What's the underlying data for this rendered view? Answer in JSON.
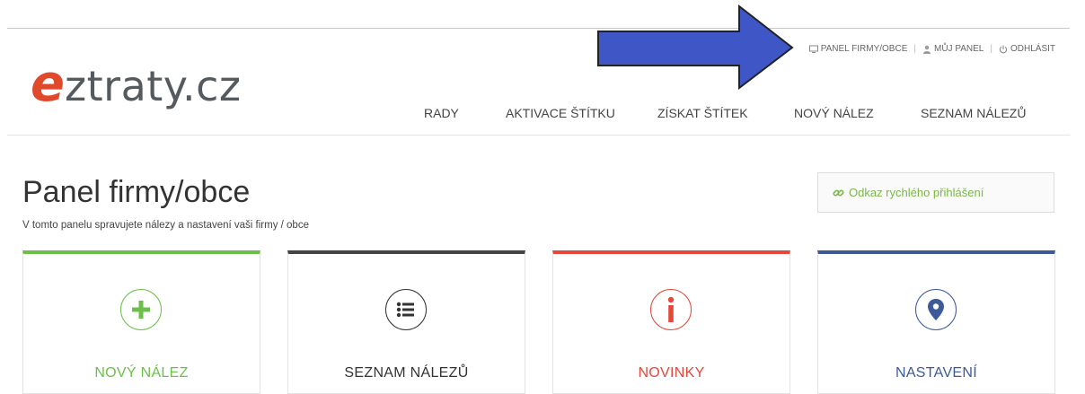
{
  "logo": {
    "e": "e",
    "rest": "ztraty.cz"
  },
  "top_nav": {
    "panel": "PANEL FIRMY/OBCE",
    "my_panel": "MŮJ PANEL",
    "logout": "ODHLÁSIT",
    "separator": "|"
  },
  "main_nav": [
    "RADY",
    "AKTIVACE ŠTÍTKU",
    "ZÍSKAT ŠTÍTEK",
    "NOVÝ NÁLEZ",
    "SEZNAM NÁLEZŮ"
  ],
  "page": {
    "title": "Panel firmy/obce",
    "subtitle": "V tomto panelu spravujete nálezy a nastavení vaši firmy / obce",
    "quick_login": "Odkaz rychlého přihlášení"
  },
  "cards": [
    {
      "label": "NOVÝ NÁLEZ",
      "color": "#6cc04a",
      "icon": "plus-icon"
    },
    {
      "label": "SEZNAM NÁLEZŮ",
      "color": "#444444",
      "icon": "list-icon"
    },
    {
      "label": "NOVINKY",
      "color": "#e5473a",
      "icon": "info-icon"
    },
    {
      "label": "NASTAVENÍ",
      "color": "#3c5a9a",
      "icon": "map-pin-icon"
    }
  ],
  "colors": {
    "brand_red": "#e0492c",
    "accent_green": "#7ab648",
    "arrow_blue": "#3f56c6"
  }
}
